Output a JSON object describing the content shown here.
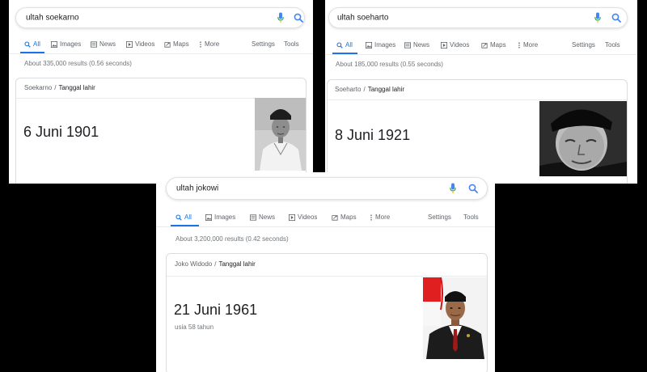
{
  "panels": [
    {
      "query": "ultah soekarno",
      "tabs": [
        "All",
        "Images",
        "News",
        "Videos",
        "Maps",
        "More"
      ],
      "settings": "Settings",
      "tools": "Tools",
      "stats": "About 335,000 results (0.56 seconds)",
      "breadcrumb_entity": "Soekarno",
      "breadcrumb_separator": "/",
      "breadcrumb_attr": "Tanggal lahir",
      "answer": "6 Juni 1901"
    },
    {
      "query": "ultah soeharto",
      "tabs": [
        "All",
        "Images",
        "News",
        "Videos",
        "Maps",
        "More"
      ],
      "settings": "Settings",
      "tools": "Tools",
      "stats": "About 185,000 results (0.55 seconds)",
      "breadcrumb_entity": "Soeharto",
      "breadcrumb_separator": "/",
      "breadcrumb_attr": "Tanggal lahir",
      "answer": "8 Juni 1921"
    },
    {
      "query": "ultah jokowi",
      "tabs": [
        "All",
        "Images",
        "News",
        "Videos",
        "Maps",
        "More"
      ],
      "settings": "Settings",
      "tools": "Tools",
      "stats": "About 3,200,000 results (0.42 seconds)",
      "breadcrumb_entity": "Joko Widodo",
      "breadcrumb_separator": "/",
      "breadcrumb_attr": "Tanggal lahir",
      "answer": "21 Juni 1961",
      "sub": "usia 58 tahun"
    }
  ],
  "colors": {
    "accent": "#1a73e8",
    "text": "#202124",
    "muted": "#5f6368",
    "background": "#000000"
  },
  "icons": [
    "search-icon",
    "mic-icon",
    "images-icon",
    "news-icon",
    "videos-icon",
    "maps-icon",
    "more-icon"
  ]
}
